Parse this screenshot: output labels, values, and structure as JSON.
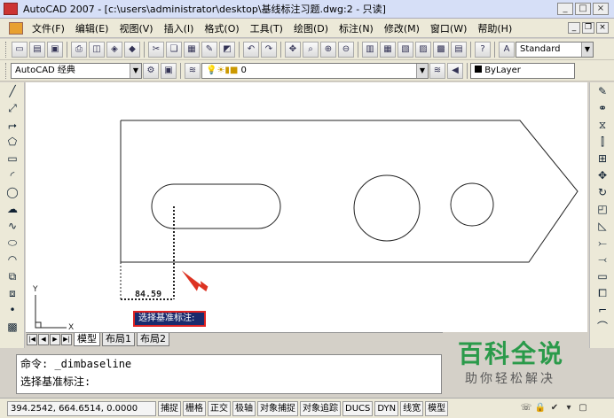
{
  "window": {
    "title": "AutoCAD 2007 - [c:\\users\\administrator\\desktop\\基线标注习题.dwg:2 - 只读]"
  },
  "menu": {
    "items": [
      {
        "label": "文件(F)"
      },
      {
        "label": "编辑(E)"
      },
      {
        "label": "视图(V)"
      },
      {
        "label": "插入(I)"
      },
      {
        "label": "格式(O)"
      },
      {
        "label": "工具(T)"
      },
      {
        "label": "绘图(D)"
      },
      {
        "label": "标注(N)"
      },
      {
        "label": "修改(M)"
      },
      {
        "label": "窗口(W)"
      },
      {
        "label": "帮助(H)"
      }
    ]
  },
  "toolbar": {
    "text_style": "Standard",
    "workspace": "AutoCAD 经典",
    "layer": "0",
    "linetype": "ByLayer"
  },
  "drawing": {
    "dimension_text": "84.59",
    "axis_y": "Y",
    "axis_x": "X"
  },
  "tooltip": {
    "text": "选择基准标注:"
  },
  "layout_tabs": [
    {
      "label": "模型",
      "active": true
    },
    {
      "label": "布局1",
      "active": false
    },
    {
      "label": "布局2",
      "active": false
    }
  ],
  "command": {
    "line1": "命令: _dimbaseline",
    "line2": "选择基准标注:"
  },
  "watermark": {
    "title": "百科全说",
    "subtitle": "助你轻松解决"
  },
  "status": {
    "coords": "394.2542, 664.6514, 0.0000",
    "toggles": [
      "捕捉",
      "栅格",
      "正交",
      "极轴",
      "对象捕捉",
      "对象追踪",
      "DUCS",
      "DYN",
      "线宽",
      "模型"
    ]
  },
  "colors": {
    "tooltip_bg": "#1a2a6c",
    "tooltip_border": "#dd2222",
    "arrow": "#dd3322",
    "watermark": "#2a9a4a"
  }
}
